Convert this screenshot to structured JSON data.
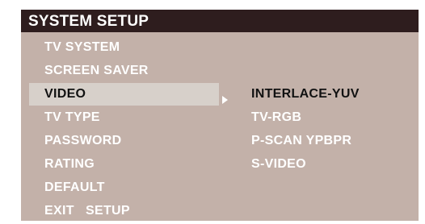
{
  "menu": {
    "title": "SYSTEM SETUP",
    "items": [
      {
        "label": "TV SYSTEM"
      },
      {
        "label": "SCREEN SAVER"
      },
      {
        "label": "VIDEO"
      },
      {
        "label": "TV TYPE"
      },
      {
        "label": "PASSWORD"
      },
      {
        "label": "RATING"
      },
      {
        "label": "DEFAULT"
      },
      {
        "label": "EXIT   SETUP"
      }
    ],
    "selected_item": "VIDEO",
    "submenu": {
      "items": [
        {
          "label": "INTERLACE-YUV"
        },
        {
          "label": "TV-RGB"
        },
        {
          "label": "P-SCAN YPBPR"
        },
        {
          "label": "S-VIDEO"
        }
      ]
    }
  },
  "colors": {
    "title_bar": "#2e1d1e",
    "panel": "#c3b1a9",
    "selection": "#d7d0ca",
    "text_normal": "#ffffff",
    "text_selected": "#111111"
  },
  "icons": {
    "submenu_indicator": "triangle-right-icon"
  }
}
